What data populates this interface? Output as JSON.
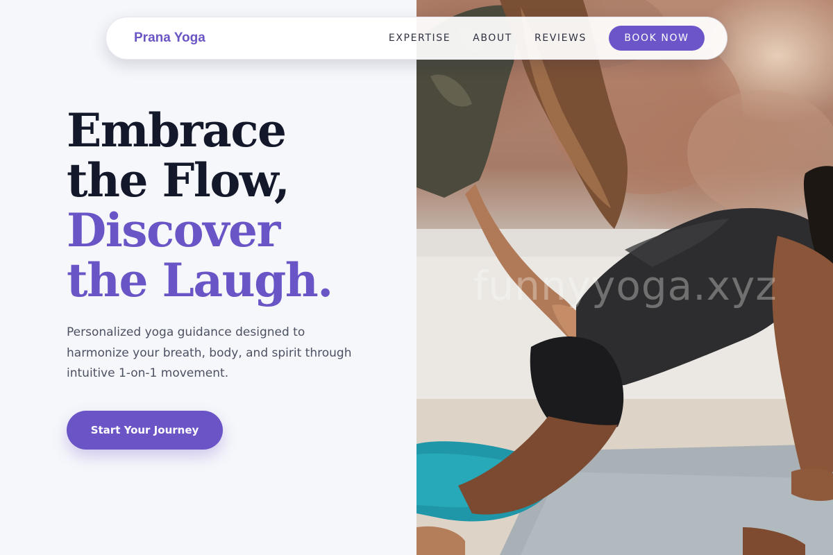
{
  "brand": {
    "name": "Prana Yoga"
  },
  "nav": {
    "links": [
      {
        "label": "EXPERTISE"
      },
      {
        "label": "ABOUT"
      },
      {
        "label": "REVIEWS"
      }
    ],
    "cta_label": "BOOK NOW"
  },
  "hero": {
    "title_lines": [
      "Embrace",
      "the Flow,",
      "Discover",
      "the Laugh."
    ],
    "subtitle": "Personalized yoga guidance designed to harmonize your breath, body, and spirit through intuitive 1-on-1 movement.",
    "cta_label": "Start Your Journey"
  },
  "photo": {
    "watermark": "funnyyoga.xyz",
    "description_icon": "yoga-assist-photo"
  },
  "colors": {
    "accent": "#6a55c6",
    "heading": "#14182b",
    "body_text": "#4c5162",
    "background": "#f6f7fb"
  }
}
